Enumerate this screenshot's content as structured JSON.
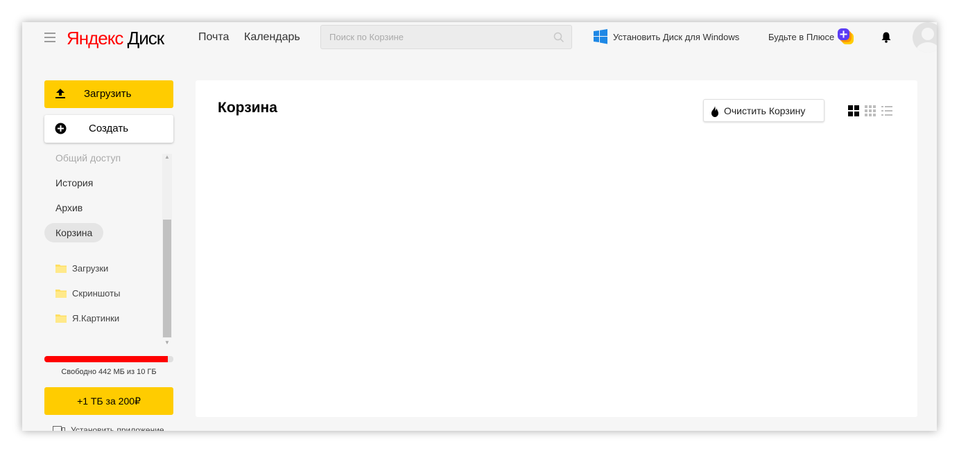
{
  "header": {
    "logo_yandex": "Яндекс",
    "logo_disk": "Диск",
    "nav_mail": "Почта",
    "nav_calendar": "Календарь",
    "search_placeholder": "Поиск по Корзине",
    "install_windows": "Установить Диск для Windows",
    "plus_text": "Будьте в Плюсе"
  },
  "sidebar": {
    "upload_label": "Загрузить",
    "create_label": "Создать",
    "items": [
      {
        "label": "Общий доступ"
      },
      {
        "label": "История"
      },
      {
        "label": "Архив"
      },
      {
        "label": "Корзина"
      }
    ],
    "folders": [
      {
        "label": "Загрузки"
      },
      {
        "label": "Скриншоты"
      },
      {
        "label": "Я.Картинки"
      }
    ],
    "space_used_fraction": 0.957,
    "space_text": "Свободно 442 МБ из 10 ГБ",
    "plus1tb_label": "+1 ТБ за 200₽",
    "install_app_label": "Установить приложение"
  },
  "main": {
    "title": "Корзина",
    "clear_button": "Очистить Корзину"
  },
  "colors": {
    "accent_yellow": "#ffcc00",
    "logo_red": "#ff0000",
    "space_bar_red": "#ff0000",
    "windows_blue": "#1e88e5"
  }
}
